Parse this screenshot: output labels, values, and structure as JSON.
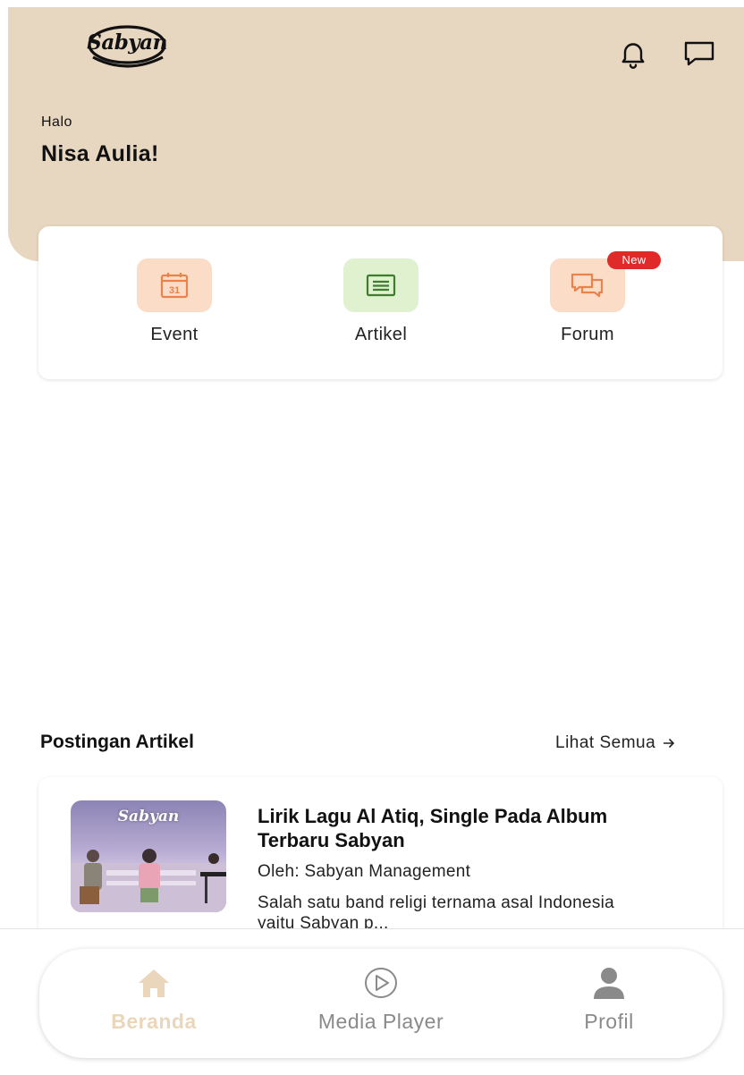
{
  "header": {
    "logo_text": "Sabyan",
    "greeting": "Halo",
    "user_name": "Nisa Aulia!"
  },
  "menu": {
    "items": [
      {
        "label": "Event",
        "icon": "calendar-icon",
        "icon_bg": "#fbdcc6",
        "icon_color": "#e8834e",
        "calendar_day": "31"
      },
      {
        "label": "Artikel",
        "icon": "article-icon",
        "icon_bg": "#dff1cf",
        "icon_color": "#3f7d2e"
      },
      {
        "label": "Forum",
        "icon": "chat-icon",
        "icon_bg": "#fbdcc6",
        "icon_color": "#e8834e",
        "badge": "New"
      }
    ]
  },
  "articles_section": {
    "title": "Postingan Artikel",
    "see_all": "Lihat Semua",
    "items": [
      {
        "thumb_logo": "Sabyan",
        "title": "Lirik Lagu Al Atiq, Single Pada Album Terbaru Sabyan",
        "author": "Oleh: Sabyan Management",
        "snippet": "Salah satu band religi ternama asal Indonesia yaitu Sabyan p..."
      }
    ]
  },
  "bottom_nav": {
    "items": [
      {
        "label": "Beranda",
        "icon": "home-icon",
        "active": true
      },
      {
        "label": "Media Player",
        "icon": "play-circle-icon",
        "active": false
      },
      {
        "label": "Profil",
        "icon": "user-icon",
        "active": false
      }
    ]
  },
  "colors": {
    "header_bg": "#e7d6c0",
    "badge_red": "#e02a2a",
    "nav_active": "#e9d6bb",
    "nav_inactive": "#8a8a8a"
  }
}
